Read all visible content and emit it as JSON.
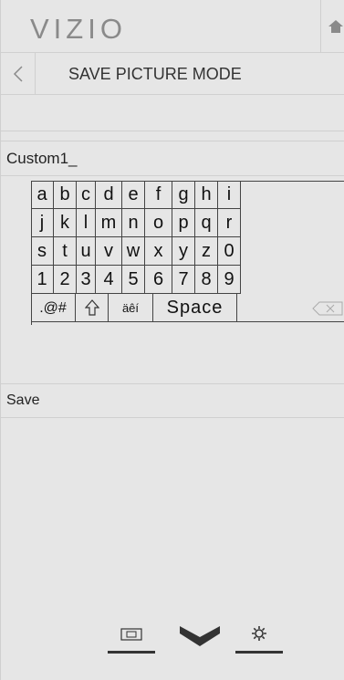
{
  "brand": {
    "logo_text": "VIZIO"
  },
  "header": {
    "home_icon": "home-icon"
  },
  "titlebar": {
    "title": "SAVE PICTURE MODE",
    "back_icon": "back-arrow-icon"
  },
  "input": {
    "value": "Custom1_"
  },
  "keyboard": {
    "rows": [
      [
        "a",
        "b",
        "c",
        "d",
        "e",
        "f",
        "g",
        "h",
        "i"
      ],
      [
        "j",
        "k",
        "l",
        "m",
        "n",
        "o",
        "p",
        "q",
        "r"
      ],
      [
        "s",
        "t",
        "u",
        "v",
        "w",
        "x",
        "y",
        "z",
        "0"
      ],
      [
        "1",
        "2",
        "3",
        "4",
        "5",
        "6",
        "7",
        "8",
        "9"
      ]
    ],
    "symbols_key": ".@#",
    "shift_icon": "shift-icon",
    "accents_key": "äêí",
    "space_key": "Space",
    "backspace_icon": "backspace-icon"
  },
  "actions": {
    "save_label": "Save"
  },
  "footer": {
    "icons": [
      "input-icon",
      "vizio-v-icon",
      "settings-gear-icon"
    ]
  },
  "colors": {
    "panel_bg": "#e6e6e6",
    "text": "#222222",
    "divider": "#d0d0d0"
  }
}
